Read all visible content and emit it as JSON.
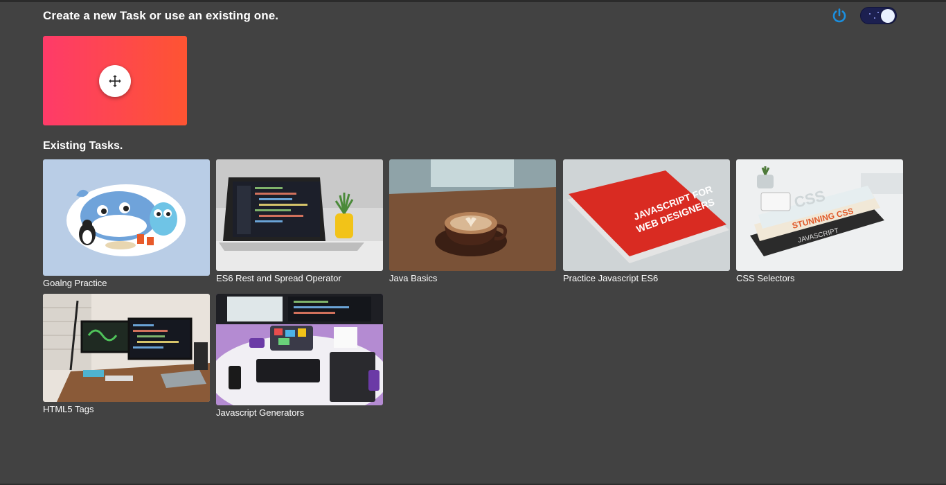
{
  "header": {
    "title": "Create a new Task or use an existing one.",
    "power_icon": "power-icon",
    "theme_toggle_state": "dark",
    "accent": "#1a8fe0"
  },
  "new_task": {
    "icon": "plus-icon",
    "gradient": [
      "#fe3b69",
      "#fe5432"
    ]
  },
  "existing": {
    "title": "Existing Tasks.",
    "tasks": [
      {
        "label": "Goalng Practice",
        "image": "gopher-and-docker-whale-illustration"
      },
      {
        "label": "ES6 Rest and Spread Operator",
        "image": "laptop-with-code-and-plant"
      },
      {
        "label": "Java Basics",
        "image": "coffee-cup-latte-art"
      },
      {
        "label": "Practice Javascript ES6",
        "image": "javascript-for-web-designers-book"
      },
      {
        "label": "CSS Selectors",
        "image": "stack-of-css-books-and-phone"
      },
      {
        "label": "HTML5 Tags",
        "image": "desk-setup-with-monitors"
      },
      {
        "label": "Javascript Generators",
        "image": "top-down-desk-with-keyboard"
      }
    ]
  }
}
